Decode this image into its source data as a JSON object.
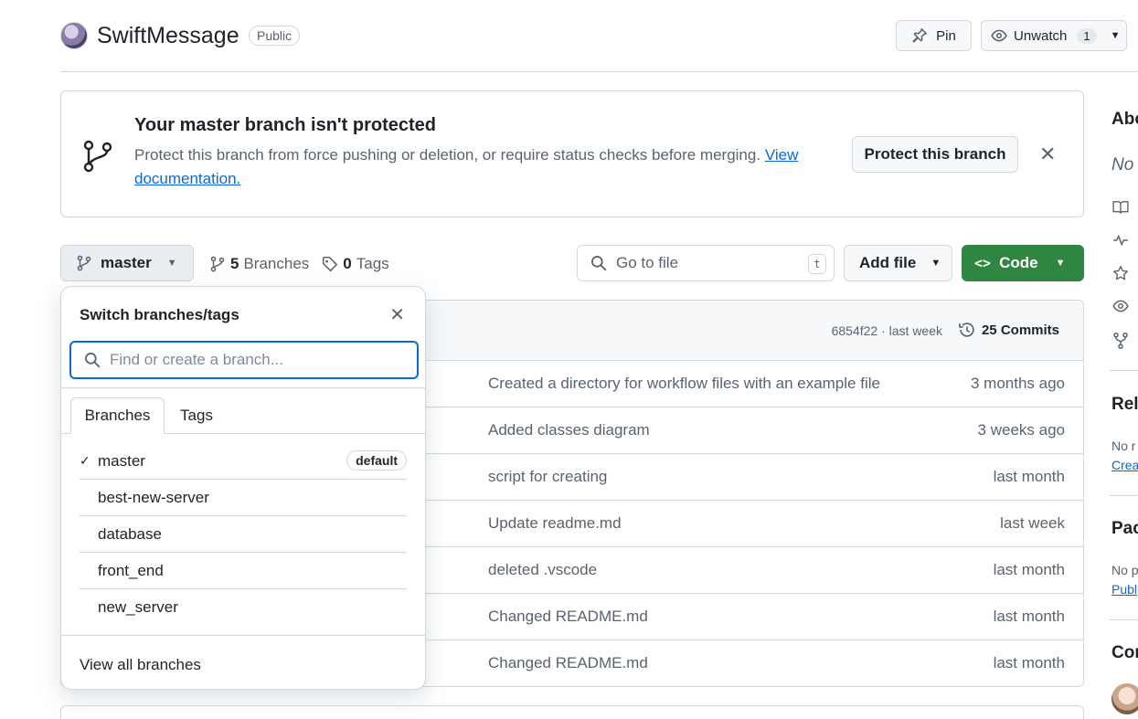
{
  "repo": {
    "name": "SwiftMessage",
    "visibility": "Public",
    "pin_label": "Pin",
    "watch_label": "Unwatch",
    "watch_count": "1"
  },
  "banner": {
    "title": "Your master branch isn't protected",
    "text": "Protect this branch from force pushing or deletion, or require status checks before merging.",
    "link": "View documentation.",
    "button": "Protect this branch"
  },
  "toolbar": {
    "branch": "master",
    "branches_count": "5",
    "branches_label": "Branches",
    "tags_count": "0",
    "tags_label": "Tags",
    "goto_placeholder": "Go to file",
    "goto_key": "t",
    "add_file": "Add file",
    "code": "Code"
  },
  "filelist": {
    "commit_meta": "6854f22 · last week",
    "commits_label": "25 Commits",
    "rows": [
      {
        "message": "Created a directory for workflow files with an example file",
        "time": "3 months ago"
      },
      {
        "message": "Added classes diagram",
        "time": "3 weeks ago"
      },
      {
        "message": "script for creating",
        "time": "last month"
      },
      {
        "message": "Update readme.md",
        "time": "last week"
      },
      {
        "message": "deleted .vscode",
        "time": "last month"
      },
      {
        "message": "Changed README.md",
        "time": "last month"
      },
      {
        "message": "Changed README.md",
        "time": "last month"
      }
    ]
  },
  "dropdown": {
    "title": "Switch branches/tags",
    "search_placeholder": "Find or create a branch...",
    "tabs": [
      "Branches",
      "Tags"
    ],
    "branches": [
      "master",
      "best-new-server",
      "database",
      "front_end",
      "new_server"
    ],
    "default_badge": "default",
    "view_all": "View all branches"
  },
  "sidebar": {
    "about": "Abo",
    "no_desc": "No",
    "releases": "Rele",
    "releases_text": "No r",
    "releases_link": "Crea",
    "packages": "Pac",
    "packages_text": "No p",
    "packages_link": "Publ",
    "contributors": "Con"
  },
  "colors": {
    "accent": "#0969da",
    "code_green": "#2f8641",
    "border": "#d0d7de",
    "muted_text": "#59636e"
  }
}
